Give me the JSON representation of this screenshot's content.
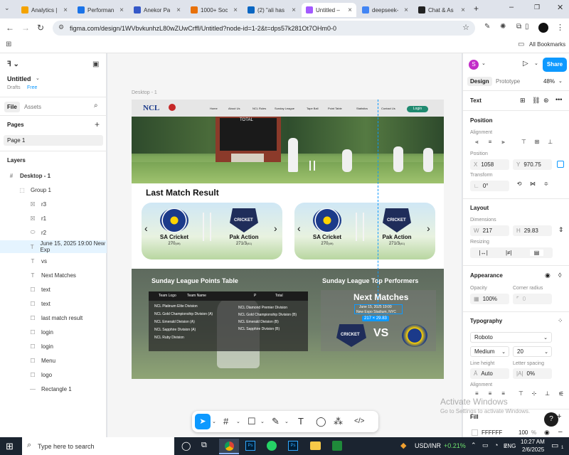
{
  "tabs": [
    {
      "title": "Analytics |",
      "color": "#f4a300"
    },
    {
      "title": "Performan",
      "color": "#1a73e8"
    },
    {
      "title": "Anekor Pa",
      "color": "#3558c8"
    },
    {
      "title": "1000+ Soc",
      "color": "#e8710a"
    },
    {
      "title": "(2) \"ali has",
      "color": "#0a66c2"
    },
    {
      "title": "Untitled –",
      "color": "#a259ff"
    },
    {
      "title": "deepseek-",
      "color": "#4285f4"
    },
    {
      "title": "Chat & As",
      "color": "#222222"
    }
  ],
  "address": {
    "url": "figma.com/design/1WVbvkunhzL80wZUwCrffl/Untitled?node-id=1-2&t=dps57k281Ot7OHm0-0"
  },
  "bookmarks": {
    "all": "All Bookmarks"
  },
  "left": {
    "file_name": "Untitled",
    "drafts": "Drafts",
    "plan": "Free",
    "tab_file": "File",
    "tab_assets": "Assets",
    "pages_title": "Pages",
    "page1": "Page 1",
    "layers_title": "Layers",
    "layers": [
      {
        "name": "Desktop - 1",
        "icon": "#",
        "indent": 0
      },
      {
        "name": "Group 1",
        "icon": "⬚",
        "indent": 1
      },
      {
        "name": "r3",
        "icon": "☒",
        "indent": 2
      },
      {
        "name": "r1",
        "icon": "☒",
        "indent": 2
      },
      {
        "name": "r2",
        "icon": "⬭",
        "indent": 2
      },
      {
        "name": "June 15, 2025 19:00 New Exp",
        "icon": "T",
        "indent": 2
      },
      {
        "name": "vs",
        "icon": "T",
        "indent": 2
      },
      {
        "name": "Next Matches",
        "icon": "T",
        "indent": 2
      },
      {
        "name": "text",
        "icon": "☐",
        "indent": 2
      },
      {
        "name": "text",
        "icon": "☐",
        "indent": 2
      },
      {
        "name": "last match result",
        "icon": "☐",
        "indent": 2
      },
      {
        "name": "login",
        "icon": "☐",
        "indent": 2
      },
      {
        "name": "login",
        "icon": "☐",
        "indent": 2
      },
      {
        "name": "Menu",
        "icon": "☐",
        "indent": 2
      },
      {
        "name": "logo",
        "icon": "☐",
        "indent": 2
      },
      {
        "name": "Rectangle 1",
        "icon": "—",
        "indent": 2
      }
    ]
  },
  "canvas": {
    "frame_label": "Desktop - 1",
    "site": {
      "logo": "NCL",
      "nav": [
        "Home",
        "About Us",
        "NCL Rules",
        "Sunday League",
        "Tape Ball",
        "Point Table",
        "Statistics",
        "Contact Us"
      ],
      "login": "Login",
      "scoreboard": "TOTAL",
      "last_match_title": "Last Match Result",
      "cards": [
        {
          "t1": "SA Cricket",
          "s1": "270",
          "o1": "(49)",
          "t2": "Pak Action",
          "s2": "271/3",
          "o2": "(41)"
        },
        {
          "t1": "SA Cricket",
          "s1": "270",
          "o1": "(49)",
          "t2": "Pak Action",
          "s2": "271/3",
          "o2": "(41)"
        }
      ],
      "points_title": "Sunday League Points Table",
      "table_headers": [
        "Team Logo",
        "Team Name",
        "P",
        "Total"
      ],
      "table_left": [
        "NCL Platinum Elite Division",
        "NCL Gold Championship Division (A)",
        "NCL Emerald Division (A)",
        "NCL Sapphire Division (A)",
        "NCL Ruby Division"
      ],
      "table_right": [
        "NCL Diamond Premier Division",
        "NCL Gold Championship Division (B)",
        "NCL Emerald Division (B)",
        "NCL Sapphire Division (B)"
      ],
      "performers_title": "Sunday League Top Performers",
      "next_title": "Next Matches",
      "next_date": "June 15, 2025 19:00",
      "next_venue": "New Expo Stadium, NYC",
      "selection_size": "217 × 29.83",
      "vs": "VS",
      "cricket_badge": "CRICKET"
    }
  },
  "right": {
    "avatar": "S",
    "share": "Share",
    "tab_design": "Design",
    "tab_prototype": "Prototype",
    "zoom": "48%",
    "layer_type": "Text",
    "position_title": "Position",
    "alignment_label": "Alignment",
    "position_label": "Position",
    "x": "1058",
    "y": "970.75",
    "transform_label": "Transform",
    "rotation": "0°",
    "layout_title": "Layout",
    "dimensions_label": "Dimensions",
    "w": "217",
    "h": "29.83",
    "resizing_label": "Resizing",
    "appearance_title": "Appearance",
    "opacity_label": "Opacity",
    "opacity": "100%",
    "radius_label": "Corner radius",
    "radius": "0",
    "typography_title": "Typography",
    "font": "Roboto",
    "weight": "Medium",
    "size": "20",
    "line_height_label": "Line height",
    "line_height": "Auto",
    "letter_spacing_label": "Letter spacing",
    "letter_spacing": "0%",
    "alignment2_label": "Alignment",
    "fill_title": "Fill",
    "fill_hex": "FFFFFF",
    "fill_opacity": "100",
    "fill_pct": "%"
  },
  "watermark": {
    "line1": "Activate Windows",
    "line2": "Go to Settings to activate Windows."
  },
  "taskbar": {
    "search": "Type here to search",
    "ticker": "USD/INR",
    "change": "+0.21%",
    "lang": "ENG",
    "time": "10:27 AM",
    "date": "2/6/2025",
    "notif": "1"
  },
  "colors": {
    "figma_blue": "#0d99ff",
    "selection": "#0d99ff",
    "accent_green": "#1f8a70"
  }
}
